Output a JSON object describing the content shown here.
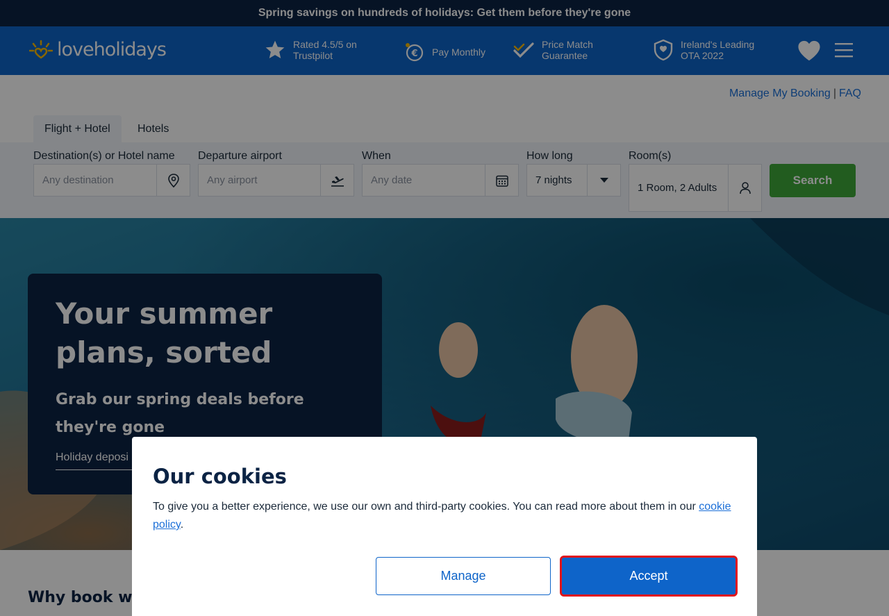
{
  "promo": {
    "text": "Spring savings on hundreds of holidays: Get them before they're gone"
  },
  "header": {
    "logo_text": "loveholidays",
    "usps": [
      {
        "icon": "star-icon",
        "text": "Rated 4.5/5 on Trustpilot"
      },
      {
        "icon": "euro-coin-icon",
        "text": "Pay Monthly"
      },
      {
        "icon": "check-icon",
        "text": "Price Match Guarantee"
      },
      {
        "icon": "shield-icon",
        "text": "Ireland's Leading OTA 2022"
      }
    ],
    "favourites_icon": "heart-icon",
    "menu_icon": "hamburger-menu-icon"
  },
  "subnav": {
    "manage_booking": "Manage My Booking",
    "separator": "|",
    "faq": "FAQ"
  },
  "tabs": [
    {
      "label": "Flight + Hotel",
      "active": true
    },
    {
      "label": "Hotels",
      "active": false
    }
  ],
  "search": {
    "destination": {
      "label": "Destination(s) or Hotel name",
      "placeholder": "Any destination",
      "icon": "map-pin-icon"
    },
    "departure": {
      "label": "Departure airport",
      "placeholder": "Any airport",
      "icon": "plane-departure-icon"
    },
    "when": {
      "label": "When",
      "placeholder": "Any date",
      "icon": "calendar-icon"
    },
    "how_long": {
      "label": "How long",
      "value": "7 nights",
      "icon": "caret-down-icon"
    },
    "rooms": {
      "label": "Room(s)",
      "value": "1 Room, 2 Adults",
      "icon": "person-icon"
    },
    "search_button": "Search"
  },
  "hero": {
    "title": "Your summer plans, sorted",
    "subtitle": "Grab our spring deals before they're gone",
    "deposit_text": "Holiday deposi"
  },
  "why_book": "Why book wit",
  "cookie": {
    "title": "Our cookies",
    "text": "To give you a better experience, we use our own and third-party cookies. You can read more about them in our ",
    "link": "cookie policy",
    "text_end": ".",
    "manage_button": "Manage",
    "accept_button": "Accept"
  },
  "colors": {
    "navy": "#0b2344",
    "brand_blue": "#0e64c9",
    "search_green": "#3fa83a",
    "highlight_red": "#e0141a"
  }
}
